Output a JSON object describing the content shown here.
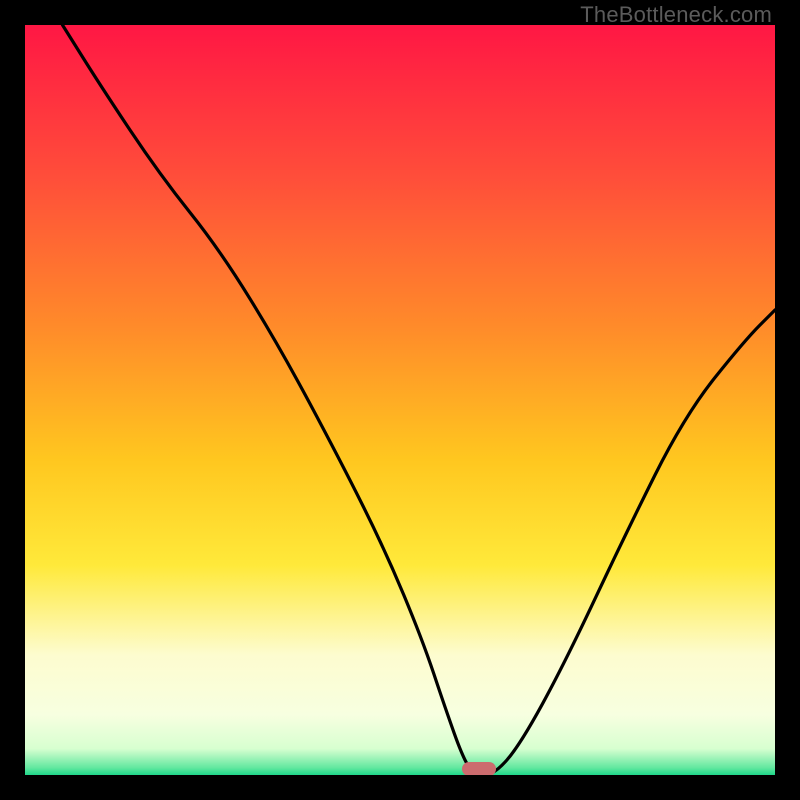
{
  "watermark": "TheBottleneck.com",
  "marker": {
    "x_pct": 60.5,
    "y_pct": 99.2
  },
  "chart_data": {
    "type": "line",
    "title": "",
    "xlabel": "",
    "ylabel": "",
    "xlim": [
      0,
      100
    ],
    "ylim": [
      0,
      100
    ],
    "grid": false,
    "legend": false,
    "gradient_stops": [
      {
        "offset": 0,
        "color": "#ff1744"
      },
      {
        "offset": 0.2,
        "color": "#ff4d3a"
      },
      {
        "offset": 0.4,
        "color": "#ff8a2a"
      },
      {
        "offset": 0.58,
        "color": "#ffc71f"
      },
      {
        "offset": 0.72,
        "color": "#ffe93a"
      },
      {
        "offset": 0.84,
        "color": "#fdfccf"
      },
      {
        "offset": 0.92,
        "color": "#f7ffe0"
      },
      {
        "offset": 0.965,
        "color": "#d7ffd0"
      },
      {
        "offset": 0.99,
        "color": "#64e8a0"
      },
      {
        "offset": 1.0,
        "color": "#1fd78a"
      }
    ],
    "series": [
      {
        "name": "bottleneck-curve",
        "x": [
          5,
          10,
          18,
          26,
          34,
          42,
          48,
          53,
          56,
          58.5,
          60,
          62.5,
          66,
          72,
          80,
          88,
          96,
          100
        ],
        "y": [
          100,
          92,
          80,
          70,
          57,
          42,
          30,
          18,
          9,
          2,
          0,
          0,
          4,
          15,
          32,
          48,
          58,
          62
        ]
      }
    ],
    "annotations": []
  }
}
